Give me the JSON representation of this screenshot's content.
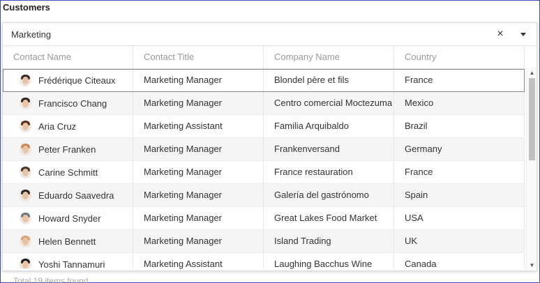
{
  "title": "Customers",
  "combo": {
    "value": "Marketing",
    "clear_label": "×"
  },
  "columns": [
    "Contact Name",
    "Contact Title",
    "Company Name",
    "Country"
  ],
  "rows": [
    {
      "name": "Frédérique Citeaux",
      "title": "Marketing Manager",
      "company": "Blondel père et fils",
      "country": "France",
      "hair": "#3a2a22"
    },
    {
      "name": "Francisco Chang",
      "title": "Marketing Manager",
      "company": "Centro comercial Moctezuma",
      "country": "Mexico",
      "hair": "#2b2420"
    },
    {
      "name": "Aria Cruz",
      "title": "Marketing Assistant",
      "company": "Familia Arquibaldo",
      "country": "Brazil",
      "hair": "#5a2f1e"
    },
    {
      "name": "Peter Franken",
      "title": "Marketing Manager",
      "company": "Frankenversand",
      "country": "Germany",
      "hair": "#c9895a"
    },
    {
      "name": "Carine Schmitt",
      "title": "Marketing Manager",
      "company": "France restauration",
      "country": "France",
      "hair": "#4a3526"
    },
    {
      "name": "Eduardo Saavedra",
      "title": "Marketing Manager",
      "company": "Galería del gastrónomo",
      "country": "Spain",
      "hair": "#2e2420"
    },
    {
      "name": "Howard Snyder",
      "title": "Marketing Manager",
      "company": "Great Lakes Food Market",
      "country": "USA",
      "hair": "#6b7a8a"
    },
    {
      "name": "Helen Bennett",
      "title": "Marketing Manager",
      "company": "Island Trading",
      "country": "UK",
      "hair": "#d9a07a"
    },
    {
      "name": "Yoshi Tannamuri",
      "title": "Marketing Assistant",
      "company": "Laughing Bacchus Wine",
      "country": "Canada",
      "hair": "#1e1a18"
    }
  ],
  "footer": "Total 19 items found"
}
